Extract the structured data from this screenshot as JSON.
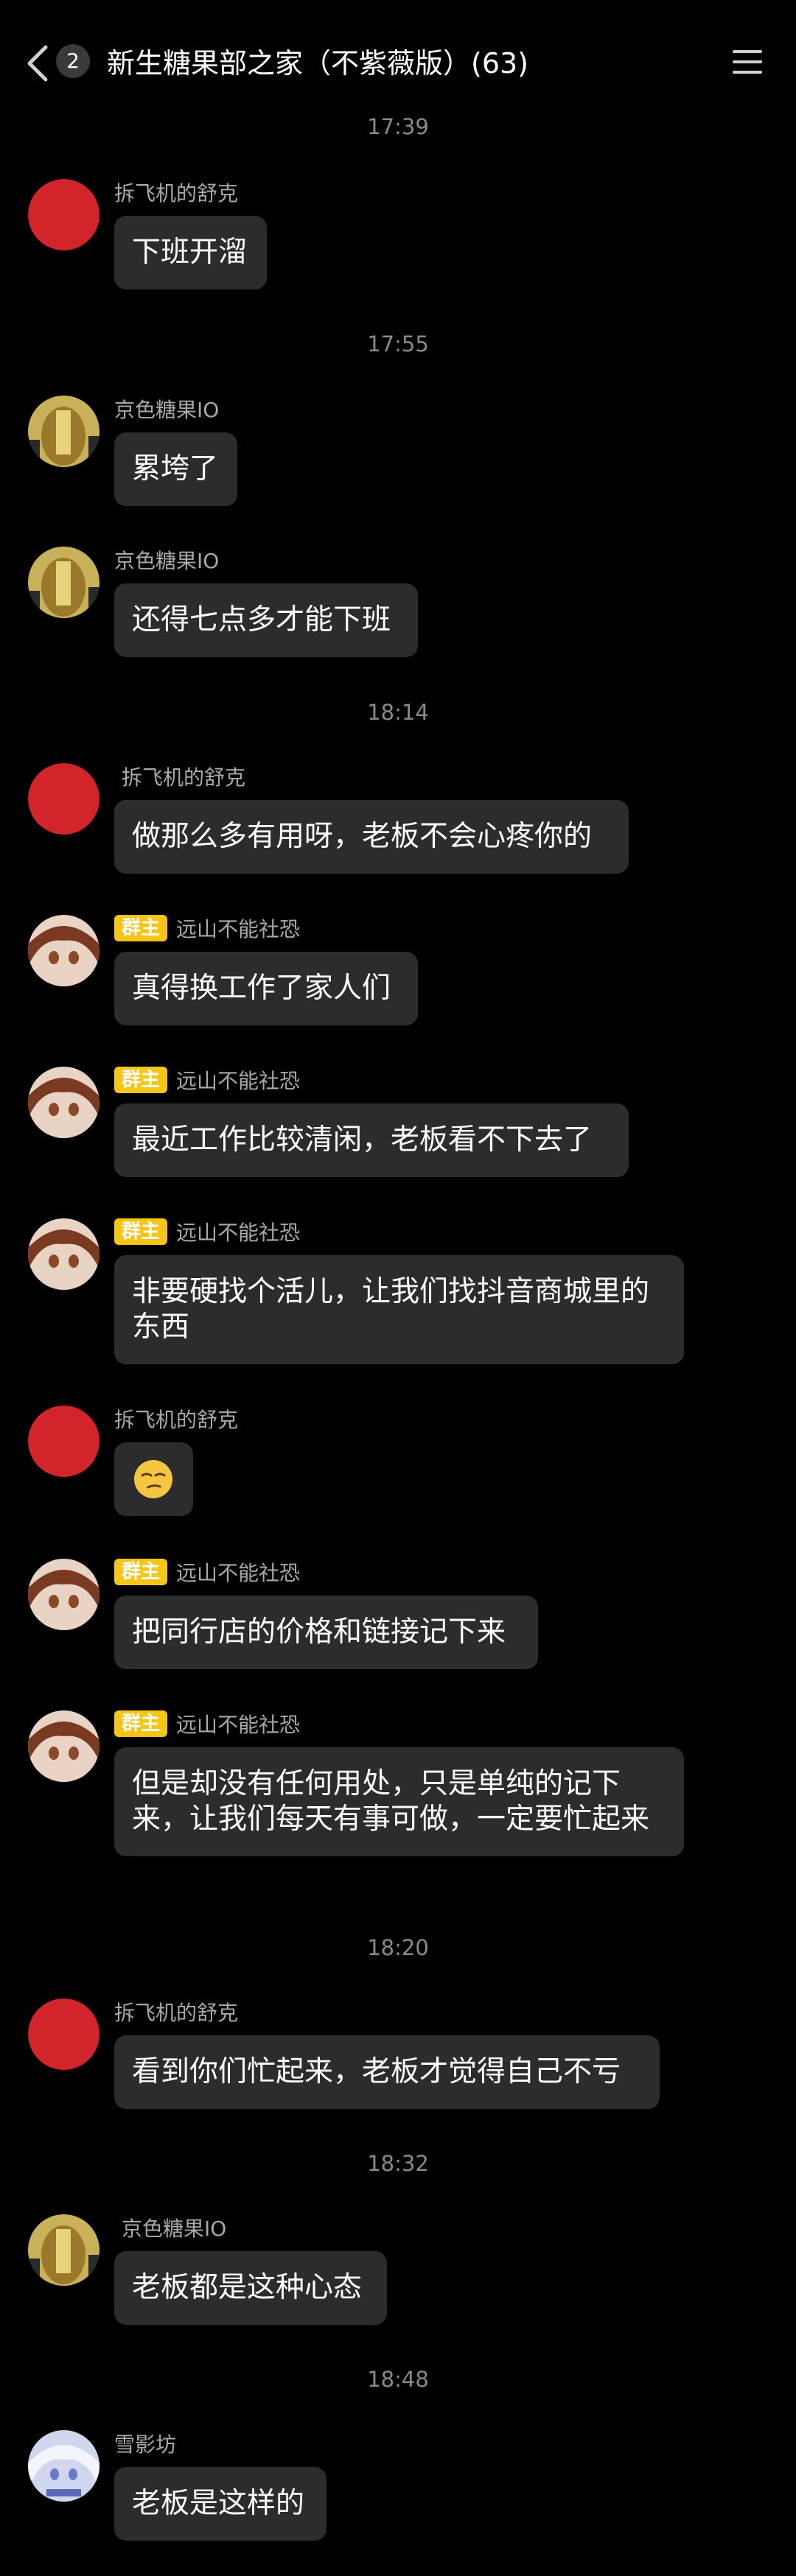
{
  "header": {
    "unread_count": "2",
    "title": "新生糖果部之家（不紫薇版）(63)"
  },
  "timestamps": [
    "17:39",
    "17:55",
    "18:14",
    "18:20",
    "18:32",
    "18:48"
  ],
  "owner_badge_label": "群主",
  "avatar_colors": {
    "red": "#d1242b",
    "bubble": "#2c2c2e",
    "background": "#000000",
    "badge": "#f5c518"
  },
  "messages": [
    {
      "sender": "拆飞机的舒克",
      "avatar": "red-circle",
      "text": "下班开溜"
    },
    {
      "sender": "京色糖果IO",
      "avatar": "gold-anime",
      "text": "累垮了"
    },
    {
      "sender": "京色糖果IO",
      "avatar": "gold-anime",
      "text": "还得七点多才能下班"
    },
    {
      "sender": "拆飞机的舒克",
      "avatar": "red-circle",
      "text": "做那么多有用呀，老板不会心疼你的"
    },
    {
      "sender": "远山不能社恐",
      "avatar": "brown-hair-anime",
      "owner": true,
      "text": "真得换工作了家人们"
    },
    {
      "sender": "远山不能社恐",
      "avatar": "brown-hair-anime",
      "owner": true,
      "text": "最近工作比较清闲，老板看不下去了"
    },
    {
      "sender": "远山不能社恐",
      "avatar": "brown-hair-anime",
      "owner": true,
      "text": "非要硬找个活儿，让我们找抖音商城里的东西"
    },
    {
      "sender": "拆飞机的舒克",
      "avatar": "red-circle",
      "text": "",
      "emoji": "smirk-emoji"
    },
    {
      "sender": "远山不能社恐",
      "avatar": "brown-hair-anime",
      "owner": true,
      "text": "把同行店的价格和链接记下来"
    },
    {
      "sender": "远山不能社恐",
      "avatar": "brown-hair-anime",
      "owner": true,
      "text": "但是却没有任何用处，只是单纯的记下来，让我们每天有事可做，一定要忙起来"
    },
    {
      "sender": "拆飞机的舒克",
      "avatar": "red-circle",
      "text": "看到你们忙起来，老板才觉得自己不亏"
    },
    {
      "sender": "京色糖果IO",
      "avatar": "gold-anime",
      "text": "老板都是这种心态"
    },
    {
      "sender": "雪影坊",
      "avatar": "white-hair-anime",
      "text": "老板是这样的"
    }
  ]
}
